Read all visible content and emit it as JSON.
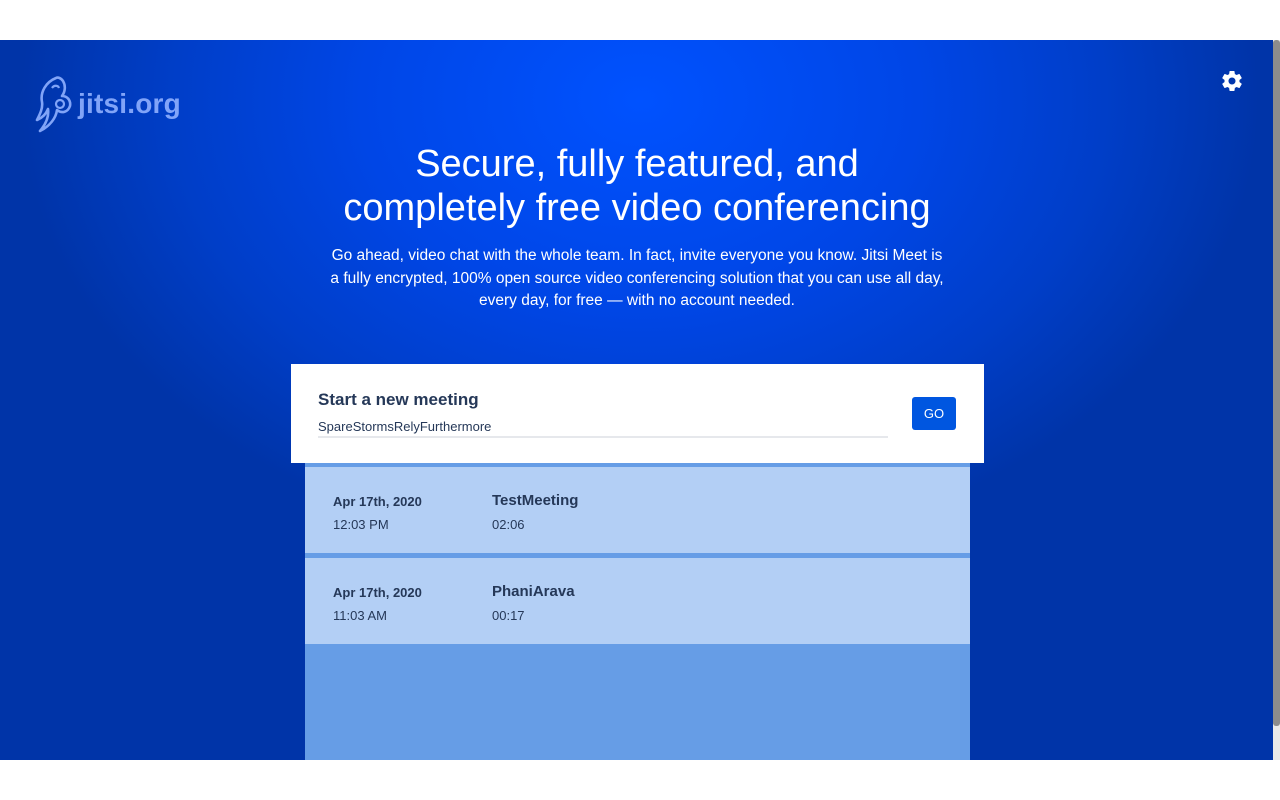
{
  "header": {
    "logo_text": "jitsi.org",
    "logo_icon": "jitsi-logo-icon",
    "settings_icon": "gear-icon"
  },
  "hero": {
    "title_line1": "Secure, fully featured, and",
    "title_line2": "completely free video conferencing",
    "description": "Go ahead, video chat with the whole team. In fact, invite everyone you know. Jitsi Meet is a fully encrypted, 100% open source video conferencing solution that you can use all day, every day, for free — with no account needed."
  },
  "enter_room": {
    "title": "Start a new meeting",
    "room_name_value": "SpareStormsRelyFurthermore",
    "go_label": "GO"
  },
  "recent_meetings": [
    {
      "date": "Apr 17th, 2020",
      "time": "12:03 PM",
      "title": "TestMeeting",
      "duration": "02:06"
    },
    {
      "date": "Apr 17th, 2020",
      "time": "11:03 AM",
      "title": "PhaniArava",
      "duration": "00:17"
    }
  ],
  "colors": {
    "background": "#0052ff",
    "go_button": "#0056e0",
    "meeting_item": "#b3cff5",
    "meetings_panel": "#669de6",
    "text_dark": "#253858"
  }
}
